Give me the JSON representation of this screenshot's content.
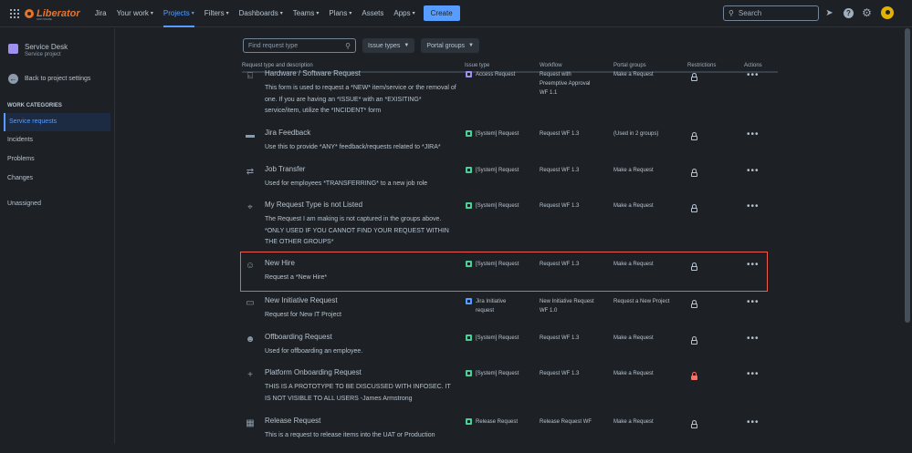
{
  "topnav": {
    "logo_text": "Liberator",
    "logo_sub": "SOFTWARE",
    "product": "Jira",
    "items": [
      {
        "label": "Your work",
        "chevron": true
      },
      {
        "label": "Projects",
        "chevron": true,
        "active": true
      },
      {
        "label": "Filters",
        "chevron": true
      },
      {
        "label": "Dashboards",
        "chevron": true
      },
      {
        "label": "Teams",
        "chevron": true
      },
      {
        "label": "Plans",
        "chevron": true
      },
      {
        "label": "Assets",
        "chevron": false
      },
      {
        "label": "Apps",
        "chevron": true
      }
    ],
    "create_label": "Create",
    "search_placeholder": "Search",
    "icons": [
      "notifications-icon",
      "help-icon",
      "settings-icon",
      "avatar"
    ]
  },
  "sidebar": {
    "project_name": "Service Desk",
    "project_type": "Service project",
    "back_label": "Back to project settings",
    "section_title": "WORK CATEGORIES",
    "items": [
      "Service requests",
      "Incidents",
      "Problems",
      "Changes",
      "Unassigned"
    ]
  },
  "filters": {
    "search_placeholder": "Find request type",
    "issue_types_label": "Issue types",
    "portal_groups_label": "Portal groups"
  },
  "table": {
    "headers": [
      "Request type and description",
      "Issue type",
      "Workflow",
      "Portal groups",
      "Restrictions",
      "Actions"
    ],
    "rows": [
      {
        "title": "Hardware / Software Request",
        "desc": "This form is used to request a *NEW* item/service or the removal of one. If you are having an *ISSUE* with an *EXISITING* service/item, utilize the *INCIDENT* form",
        "issue_type": "Access Request",
        "issue_color": "purple",
        "workflow": "Request with Preemptive Approval WF 1.1",
        "portal": "Make a Request",
        "restricted": false,
        "icon": "hardware-icon"
      },
      {
        "title": "Jira Feedback",
        "desc": "Use this to provide *ANY* feedback/requests related to *JIRA*",
        "issue_type": "[System] Request",
        "issue_color": "green",
        "workflow": "Request WF 1.3",
        "portal": "(Used in 2 groups)",
        "restricted": false,
        "icon": "feedback-icon"
      },
      {
        "title": "Job Transfer",
        "desc": "Used for employees *TRANSFERRING* to a new job role",
        "issue_type": "[System] Request",
        "issue_color": "green",
        "workflow": "Request WF 1.3",
        "portal": "Make a Request",
        "restricted": false,
        "icon": "transfer-icon"
      },
      {
        "title": "My Request Type is not Listed",
        "desc": "The Request I am making is not captured in the groups above. *ONLY USED IF YOU CANNOT FIND YOUR REQUEST WITHIN THE OTHER GROUPS*",
        "issue_type": "[System] Request",
        "issue_color": "green",
        "workflow": "Request WF 1.3",
        "portal": "Make a Request",
        "restricted": false,
        "icon": "target-icon"
      },
      {
        "title": "New Hire",
        "desc": "Request a *New Hire*",
        "issue_type": "[System] Request",
        "issue_color": "green",
        "workflow": "Request WF 1.3",
        "portal": "Make a Request",
        "restricted": false,
        "icon": "new-hire-icon"
      },
      {
        "title": "New Initiative Request",
        "desc": "Request for New IT Project",
        "issue_type": "Jira Initiative request",
        "issue_color": "blue",
        "workflow": "New Initiative Request WF 1.0",
        "portal": "Request a New Project",
        "restricted": false,
        "icon": "initiative-icon"
      },
      {
        "title": "Offboarding Request",
        "desc": "Used for offboarding an employee.",
        "issue_type": "[System] Request",
        "issue_color": "green",
        "workflow": "Request WF 1.3",
        "portal": "Make a Request",
        "restricted": false,
        "icon": "offboarding-icon"
      },
      {
        "title": "Platform Onboarding Request",
        "desc": "THIS IS A PROTOTYPE TO BE DISCUSSED WITH INFOSEC. IT IS NOT VISIBLE TO ALL USERS -James Armstrong",
        "issue_type": "[System] Request",
        "issue_color": "green",
        "workflow": "Request WF 1.3",
        "portal": "Make a Request",
        "restricted": true,
        "icon": "plus-icon"
      },
      {
        "title": "Release Request",
        "desc": "This is a request to release items into the UAT or Production",
        "issue_type": "Release Request",
        "issue_color": "green",
        "workflow": "Release Request WF",
        "portal": "Make a Request",
        "restricted": false,
        "icon": "calendar-icon"
      }
    ]
  },
  "colors": {
    "accent": "#579dff",
    "highlight": "#f15b50",
    "background": "#1d2125",
    "restricted_lock": "#f87168"
  }
}
